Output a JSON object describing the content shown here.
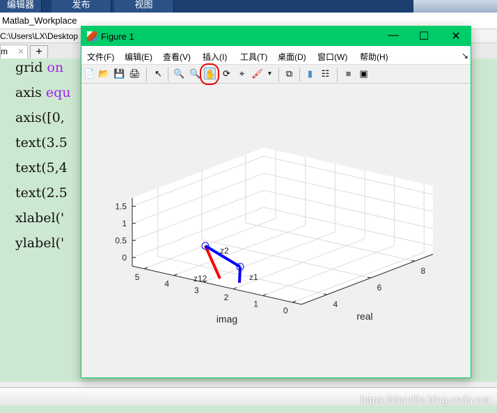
{
  "desktop": {
    "ribbon_tabs": [
      "编辑器",
      "发布",
      "视图"
    ],
    "workspace_title": "Matlab_Workplace",
    "path": "C:\\Users\\LX\\Desktop",
    "file_tab": "m",
    "code_lines": [
      {
        "a": "grid ",
        "b": "on"
      },
      {
        "a": "axis ",
        "b": "equ"
      },
      {
        "a": "axis([0,",
        "b": ""
      },
      {
        "a": "text(3.5",
        "b": ""
      },
      {
        "a": "text(5,4",
        "b": ""
      },
      {
        "a": "text(2.5",
        "b": ""
      },
      {
        "a": "xlabel('",
        "b": ""
      },
      {
        "a": "ylabel('",
        "b": ""
      }
    ],
    "watermark": "https://demllie.blog.csdn.net"
  },
  "figure": {
    "title": "Figure 1",
    "title_color": "#00cc6a",
    "menu": [
      "文件(F)",
      "编辑(E)",
      "查看(V)",
      "插入(I)",
      "工具(T)",
      "桌面(D)",
      "窗口(W)",
      "帮助(H)"
    ],
    "toolbar": [
      "new-file",
      "open",
      "save",
      "print",
      "select-arrow",
      "zoom-in",
      "zoom-out",
      "pan-hand",
      "rotate-3d",
      "data-cursor",
      "brush",
      "link-plot",
      "colorbar",
      "legend",
      "hide-plot-tools",
      "show-plot-tools"
    ],
    "active_tool": "pan-hand",
    "annotation": "red circle around pan tool",
    "plot": {
      "type": "3d-line",
      "xlabel": "real",
      "ylabel": "imag",
      "real_ticks": [
        "4",
        "6",
        "8"
      ],
      "imag_ticks": [
        "0",
        "1",
        "2",
        "3",
        "4",
        "5"
      ],
      "z_ticks": [
        "0",
        "0.5",
        "1",
        "1.5"
      ],
      "labels": {
        "z1": "z1",
        "z2": "z2",
        "z12": "z12"
      },
      "colors": {
        "vectors": "#0000ff",
        "sum": "#ff0000"
      },
      "grid": true
    }
  }
}
